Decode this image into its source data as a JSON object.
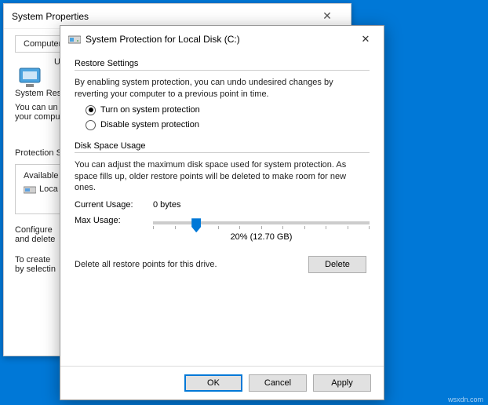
{
  "back_dialog": {
    "title": "System Properties",
    "tab_truncated": "Computer Na",
    "use_label_truncated": "Use",
    "section1_title_truncated": "System Res",
    "section1_text_truncated": "You can un\nyour compu",
    "protection_label_truncated": "Protection S",
    "available_truncated": "Available",
    "local_truncated": "Loca",
    "configure_text_truncated": "Configure\nand delete",
    "create_text_truncated": "To create\nby selectin"
  },
  "front_dialog": {
    "title": "System Protection for Local Disk (C:)",
    "restore_settings": {
      "group": "Restore Settings",
      "description": "By enabling system protection, you can undo undesired changes by reverting your computer to a previous point in time.",
      "option_on": "Turn on system protection",
      "option_off": "Disable system protection",
      "selected": "on"
    },
    "disk_space": {
      "group": "Disk Space Usage",
      "description": "You can adjust the maximum disk space used for system protection. As space fills up, older restore points will be deleted to make room for new ones.",
      "current_label": "Current Usage:",
      "current_value": "0 bytes",
      "max_label": "Max Usage:",
      "slider_percent": 20,
      "slider_text": "20% (12.70 GB)"
    },
    "delete_row": {
      "text": "Delete all restore points for this drive.",
      "button": "Delete"
    },
    "footer": {
      "ok": "OK",
      "cancel": "Cancel",
      "apply": "Apply"
    }
  },
  "watermark": "wsxdn.com"
}
